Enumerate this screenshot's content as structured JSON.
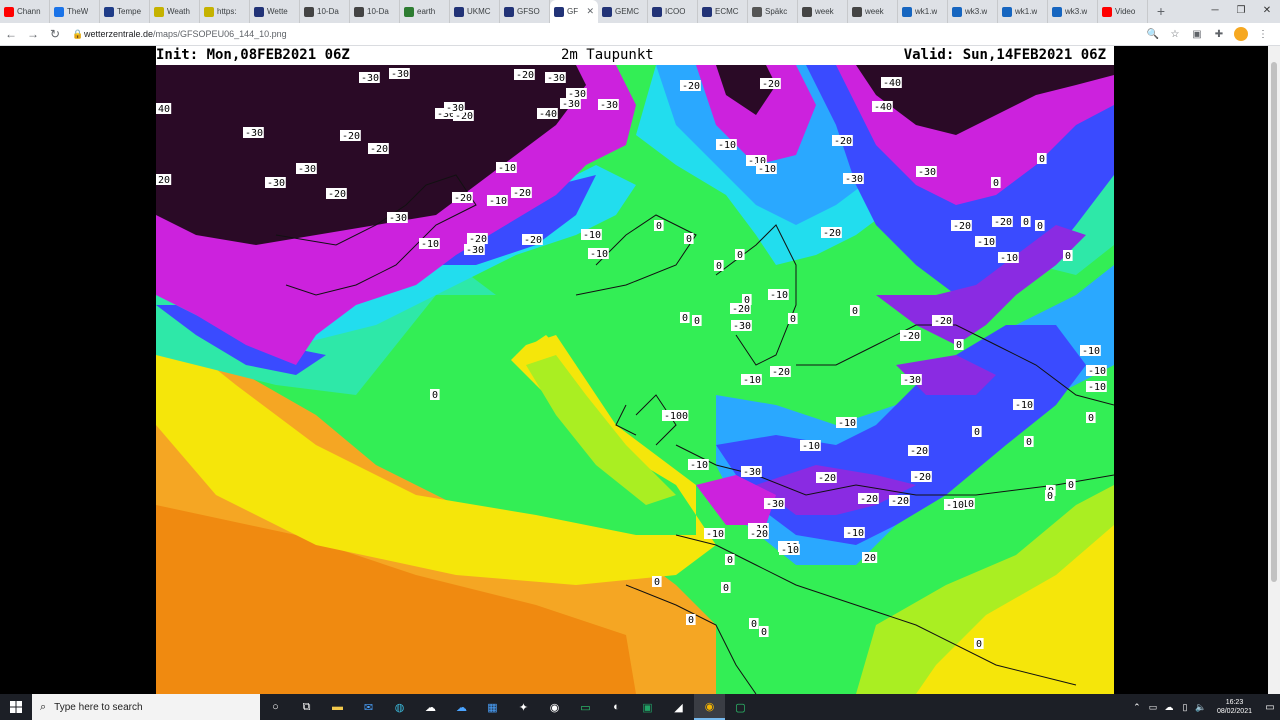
{
  "tabs": [
    {
      "label": "Chann",
      "icon": "youtube-icon",
      "color": "#ff0000"
    },
    {
      "label": "TheW",
      "icon": "weather-site-icon",
      "color": "#1a73e8"
    },
    {
      "label": "Tempe",
      "icon": "arrow-icon",
      "color": "#1f3c88"
    },
    {
      "label": "Weath",
      "icon": "striped-icon",
      "color": "#c5b200"
    },
    {
      "label": "https:",
      "icon": "striped-icon",
      "color": "#c5b200"
    },
    {
      "label": "Wette",
      "icon": "wz-icon",
      "color": "#223377"
    },
    {
      "label": "10-Da",
      "icon": "globe-icon",
      "color": "#444444"
    },
    {
      "label": "10-Da",
      "icon": "globe-icon",
      "color": "#444444"
    },
    {
      "label": "earth",
      "icon": "earth-icon",
      "color": "#2e7d32"
    },
    {
      "label": "UKMC",
      "icon": "wz-icon",
      "color": "#223377"
    },
    {
      "label": "GFSO",
      "icon": "wz-icon",
      "color": "#223377"
    },
    {
      "label": "GF",
      "icon": "wz-icon",
      "color": "#223377",
      "active": true
    },
    {
      "label": "GEMC",
      "icon": "wz-icon",
      "color": "#223377"
    },
    {
      "label": "ICOO",
      "icon": "wz-icon",
      "color": "#223377"
    },
    {
      "label": "ECMC",
      "icon": "wz-icon",
      "color": "#223377"
    },
    {
      "label": "Späkc",
      "icon": "star-icon",
      "color": "#555555"
    },
    {
      "label": "week",
      "icon": "globe-icon",
      "color": "#444444"
    },
    {
      "label": "week",
      "icon": "globe-icon",
      "color": "#444444"
    },
    {
      "label": "wk1.w",
      "icon": "shield-icon",
      "color": "#1565c0"
    },
    {
      "label": "wk3.w",
      "icon": "shield-icon",
      "color": "#1565c0"
    },
    {
      "label": "wk1.w",
      "icon": "shield-icon",
      "color": "#1565c0"
    },
    {
      "label": "wk3.w",
      "icon": "shield-icon",
      "color": "#1565c0"
    },
    {
      "label": "Video",
      "icon": "youtube-icon",
      "color": "#ff0000"
    }
  ],
  "address": {
    "host": "wetterzentrale.de",
    "path": "/maps/GFSOPEU06_144_10.png"
  },
  "map": {
    "init": "Init: Mon,08FEB2021 06Z",
    "variable": "2m Taupunkt",
    "valid": "Valid: Sun,14FEB2021 06Z",
    "colors": {
      "dark": "#2a0a26",
      "magenta": "#cc22dd",
      "violet": "#8a2be2",
      "blue": "#3a4bff",
      "lightblue": "#2aa8ff",
      "cyan": "#22ddee",
      "teal": "#2ee8a8",
      "green": "#33ee55",
      "lime": "#aaee22",
      "yellow": "#f5e60a",
      "orange": "#f5a623",
      "deeporange": "#f08a10"
    },
    "labels": [
      {
        "t": "-30"
      },
      {
        "t": "-30"
      },
      {
        "t": "-30"
      },
      {
        "t": "-20"
      },
      {
        "t": "-30"
      },
      {
        "t": "-20"
      },
      {
        "t": "-30"
      },
      {
        "t": "-30"
      },
      {
        "t": "-20"
      },
      {
        "t": "-30"
      },
      {
        "t": "-20"
      },
      {
        "t": "-30"
      },
      {
        "t": "-40"
      },
      {
        "t": "-30"
      },
      {
        "t": "-30"
      },
      {
        "t": "-20"
      },
      {
        "t": "-20"
      },
      {
        "t": "-30"
      },
      {
        "t": "-30"
      },
      {
        "t": "-20"
      },
      {
        "t": "-40"
      },
      {
        "t": "-40"
      },
      {
        "t": "-20"
      },
      {
        "t": "-10"
      },
      {
        "t": "-10"
      },
      {
        "t": "-30"
      },
      {
        "t": "-20"
      },
      {
        "t": "-30"
      },
      {
        "t": "-20"
      },
      {
        "t": "-10"
      },
      {
        "t": "-10"
      },
      {
        "t": "-20"
      },
      {
        "t": "-10"
      },
      {
        "t": "-20"
      },
      {
        "t": "-10"
      },
      {
        "t": "-10"
      },
      {
        "t": "-20"
      },
      {
        "t": "-20"
      },
      {
        "t": "-10"
      },
      {
        "t": "-10"
      },
      {
        "t": "-10"
      },
      {
        "t": "-30"
      },
      {
        "t": "-10"
      },
      {
        "t": "-20"
      },
      {
        "t": "-30"
      },
      {
        "t": "-10"
      },
      {
        "t": "-20"
      },
      {
        "t": "-20"
      },
      {
        "t": "-10"
      },
      {
        "t": "-10"
      },
      {
        "t": "-10"
      },
      {
        "t": "-20"
      },
      {
        "t": "-20"
      },
      {
        "t": "-30"
      },
      {
        "t": "-10"
      },
      {
        "t": "-100"
      },
      {
        "t": "-10"
      },
      {
        "t": "-10"
      },
      {
        "t": "-20"
      },
      {
        "t": "-20"
      },
      {
        "t": "-30"
      },
      {
        "t": "-20"
      },
      {
        "t": "-20"
      },
      {
        "t": "-20"
      },
      {
        "t": "-10"
      },
      {
        "t": "-10"
      },
      {
        "t": "-10"
      },
      {
        "t": "-10"
      },
      {
        "t": "-10"
      },
      {
        "t": "-10"
      },
      {
        "t": "-10"
      },
      {
        "t": "-30"
      },
      {
        "t": "-20"
      },
      {
        "t": "-10"
      },
      {
        "t": "0"
      },
      {
        "t": "0"
      },
      {
        "t": "0"
      },
      {
        "t": "0"
      },
      {
        "t": "0"
      },
      {
        "t": "0"
      },
      {
        "t": "0"
      },
      {
        "t": "0"
      },
      {
        "t": "0"
      },
      {
        "t": "0"
      },
      {
        "t": "0"
      },
      {
        "t": "0"
      },
      {
        "t": "0"
      },
      {
        "t": "0"
      },
      {
        "t": "0"
      },
      {
        "t": "0"
      },
      {
        "t": "0"
      },
      {
        "t": "0"
      },
      {
        "t": "0"
      },
      {
        "t": "0"
      },
      {
        "t": "0"
      },
      {
        "t": "0"
      },
      {
        "t": "0"
      },
      {
        "t": "0"
      },
      {
        "t": "0"
      },
      {
        "t": "0"
      },
      {
        "t": "0"
      },
      {
        "t": "0"
      },
      {
        "t": "0"
      },
      {
        "t": "20"
      },
      {
        "t": "20"
      },
      {
        "t": "40"
      }
    ]
  },
  "taskbar": {
    "search_placeholder": "Type here to search",
    "time": "16:23",
    "date": "08/02/2021"
  }
}
